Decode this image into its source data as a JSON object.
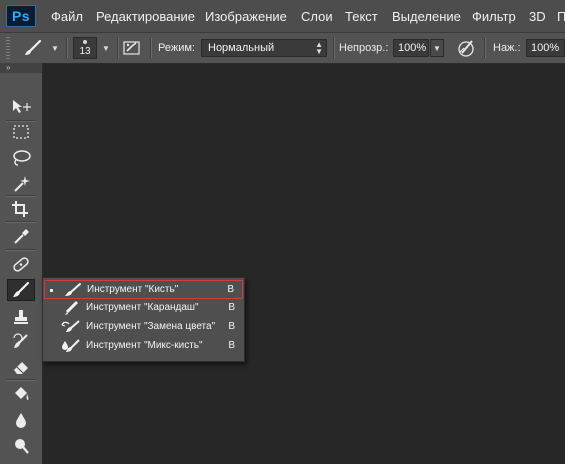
{
  "app": {
    "logo": "Ps"
  },
  "menu": {
    "items": [
      "Файл",
      "Редактирование",
      "Изображение",
      "Слои",
      "Текст",
      "Выделение",
      "Фильтр",
      "3D",
      "П"
    ]
  },
  "options": {
    "brush_size": "13",
    "mode_label": "Режим:",
    "mode_value": "Нормальный",
    "opacity_label": "Непрозр.:",
    "opacity_value": "100%",
    "pressure_label": "Наж.:",
    "pressure_value": "100%"
  },
  "toolbar": {
    "collapse_glyph": "»",
    "tools": [
      "move-tool",
      "marquee-tool",
      "lasso-tool",
      "magic-wand-tool",
      "crop-tool",
      "eyedropper-tool",
      "healing-brush-tool",
      "brush-tool",
      "clone-stamp-tool",
      "history-brush-tool",
      "eraser-tool",
      "paint-bucket-tool",
      "blur-tool",
      "dodge-tool"
    ],
    "active_tool": "brush-tool"
  },
  "flyout": {
    "items": [
      {
        "label": "Инструмент \"Кисть\"",
        "key": "B",
        "icon": "brush-icon",
        "selected": true
      },
      {
        "label": "Инструмент \"Карандаш\"",
        "key": "B",
        "icon": "pencil-icon",
        "selected": false
      },
      {
        "label": "Инструмент \"Замена цвета\"",
        "key": "B",
        "icon": "color-replacement-icon",
        "selected": false
      },
      {
        "label": "Инструмент \"Микс-кисть\"",
        "key": "B",
        "icon": "mixer-brush-icon",
        "selected": false
      }
    ]
  },
  "colors": {
    "canvas_bg": "#272727",
    "panel_bg": "#535353",
    "menubar_bg": "#4d4d4d",
    "logo_blue": "#31a8ff",
    "selection_outline": "#d43b3b"
  }
}
